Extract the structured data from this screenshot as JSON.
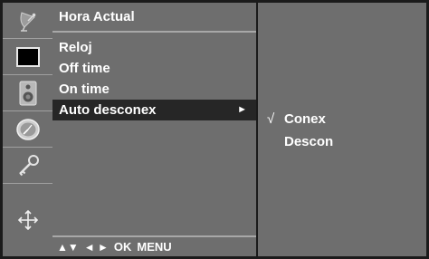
{
  "sidebar": {
    "icons": [
      {
        "name": "satellite-dish-icon"
      },
      {
        "name": "picture-icon"
      },
      {
        "name": "speaker-icon"
      },
      {
        "name": "clock-icon"
      },
      {
        "name": "key-icon"
      },
      {
        "name": "setup-arrows-icon"
      }
    ]
  },
  "menu": {
    "title": "Hora Actual",
    "items": [
      {
        "label": "Reloj"
      },
      {
        "label": "Off time"
      },
      {
        "label": "On time"
      },
      {
        "label": "Auto desconex",
        "arrow": "►",
        "selected": true
      }
    ],
    "footer": {
      "updown": "▲▼",
      "leftright": "◄ ►",
      "ok": "OK",
      "menu": "MENU"
    }
  },
  "submenu": {
    "check_mark": "√",
    "items": [
      {
        "label": "Conex",
        "checked": true
      },
      {
        "label": "Descon",
        "checked": false
      }
    ]
  },
  "colors": {
    "panel": "#6e6e6e",
    "background": "#1b1b1b",
    "highlight": "#262626",
    "text": "#ffffff"
  }
}
